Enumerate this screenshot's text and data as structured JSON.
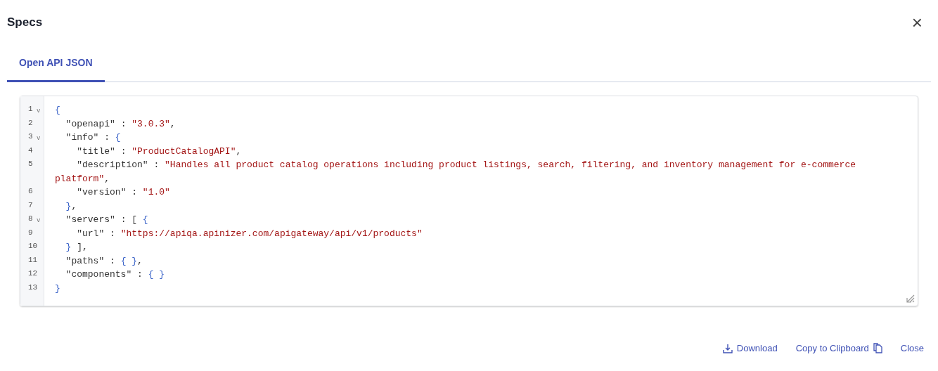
{
  "dialog": {
    "title": "Specs",
    "close_icon": "×"
  },
  "tabs": [
    {
      "label": "Open API JSON",
      "selected": true
    }
  ],
  "editor": {
    "lines": [
      {
        "number": "1",
        "fold": "v",
        "tokens": [
          {
            "kind": "bracket",
            "text": "{"
          }
        ]
      },
      {
        "number": "2",
        "tokens": [
          {
            "kind": "key",
            "text": "  \"openapi\""
          },
          {
            "kind": "punct",
            "text": " : "
          },
          {
            "kind": "string",
            "text": "\"3.0.3\""
          },
          {
            "kind": "punct",
            "text": ","
          }
        ]
      },
      {
        "number": "3",
        "fold": "v",
        "tokens": [
          {
            "kind": "key",
            "text": "  \"info\""
          },
          {
            "kind": "punct",
            "text": " : "
          },
          {
            "kind": "bracket",
            "text": "{"
          }
        ]
      },
      {
        "number": "4",
        "tokens": [
          {
            "kind": "key",
            "text": "    \"title\""
          },
          {
            "kind": "punct",
            "text": " : "
          },
          {
            "kind": "string",
            "text": "\"ProductCatalogAPI\""
          },
          {
            "kind": "punct",
            "text": ","
          }
        ]
      },
      {
        "number": "5",
        "tokens": [
          {
            "kind": "key",
            "text": "    \"description\""
          },
          {
            "kind": "punct",
            "text": " : "
          },
          {
            "kind": "string",
            "text": "\"Handles all product catalog operations including product listings, search, filtering, and inventory management for e-commerce platform\""
          },
          {
            "kind": "punct",
            "text": ","
          }
        ]
      },
      {
        "number": "6",
        "tokens": [
          {
            "kind": "key",
            "text": "    \"version\""
          },
          {
            "kind": "punct",
            "text": " : "
          },
          {
            "kind": "string",
            "text": "\"1.0\""
          }
        ]
      },
      {
        "number": "7",
        "tokens": [
          {
            "kind": "bracket",
            "text": "  }"
          },
          {
            "kind": "punct",
            "text": ","
          }
        ]
      },
      {
        "number": "8",
        "fold": "v",
        "tokens": [
          {
            "kind": "key",
            "text": "  \"servers\""
          },
          {
            "kind": "punct",
            "text": " : [ "
          },
          {
            "kind": "bracket",
            "text": "{"
          }
        ]
      },
      {
        "number": "9",
        "tokens": [
          {
            "kind": "key",
            "text": "    \"url\""
          },
          {
            "kind": "punct",
            "text": " : "
          },
          {
            "kind": "string",
            "text": "\"https://apiqa.apinizer.com/apigateway/api/v1/products\""
          }
        ]
      },
      {
        "number": "10",
        "tokens": [
          {
            "kind": "bracket",
            "text": "  }"
          },
          {
            "kind": "punct",
            "text": " ],"
          }
        ]
      },
      {
        "number": "11",
        "tokens": [
          {
            "kind": "key",
            "text": "  \"paths\""
          },
          {
            "kind": "punct",
            "text": " : "
          },
          {
            "kind": "bracket",
            "text": "{ }"
          },
          {
            "kind": "punct",
            "text": ","
          }
        ]
      },
      {
        "number": "12",
        "tokens": [
          {
            "kind": "key",
            "text": "  \"components\""
          },
          {
            "kind": "punct",
            "text": " : "
          },
          {
            "kind": "bracket",
            "text": "{ }"
          }
        ]
      },
      {
        "number": "13",
        "tokens": [
          {
            "kind": "bracket",
            "text": "}"
          }
        ]
      }
    ]
  },
  "actions": [
    {
      "kind": "download",
      "label": "Download"
    },
    {
      "kind": "copy",
      "label": "Copy to Clipboard"
    },
    {
      "kind": "close",
      "label": "Close"
    }
  ]
}
